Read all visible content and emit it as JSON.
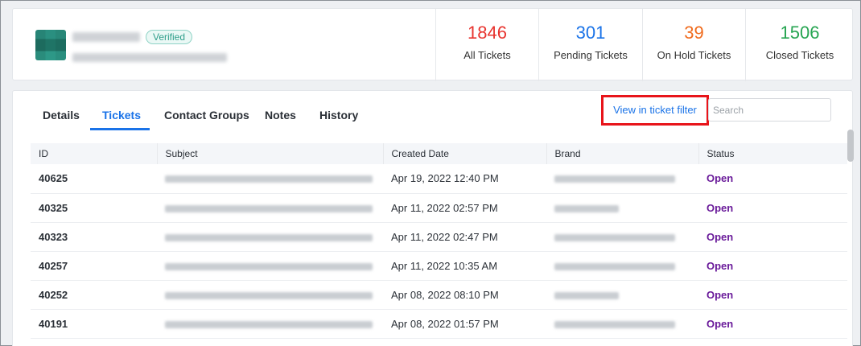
{
  "profile": {
    "verified_label": "Verified"
  },
  "stats": [
    {
      "value": "1846",
      "label": "All Tickets",
      "color": "#e8342f"
    },
    {
      "value": "301",
      "label": "Pending Tickets",
      "color": "#1a73e8"
    },
    {
      "value": "39",
      "label": "On Hold Tickets",
      "color": "#f06b1d"
    },
    {
      "value": "1506",
      "label": "Closed Tickets",
      "color": "#27a552"
    }
  ],
  "tabs": [
    "Details",
    "Tickets",
    "Contact Groups",
    "Notes",
    "History"
  ],
  "active_tab": "Tickets",
  "filter_link": "View in ticket filter",
  "search": {
    "placeholder": "Search",
    "value": ""
  },
  "table": {
    "columns": [
      "ID",
      "Subject",
      "Created Date",
      "Brand",
      "Status"
    ],
    "rows": [
      {
        "id": "40625",
        "created": "Apr 19, 2022 12:40 PM",
        "status": "Open"
      },
      {
        "id": "40325",
        "created": "Apr 11, 2022 02:57 PM",
        "status": "Open"
      },
      {
        "id": "40323",
        "created": "Apr 11, 2022 02:47 PM",
        "status": "Open"
      },
      {
        "id": "40257",
        "created": "Apr 11, 2022 10:35 AM",
        "status": "Open"
      },
      {
        "id": "40252",
        "created": "Apr 08, 2022 08:10 PM",
        "status": "Open"
      },
      {
        "id": "40191",
        "created": "Apr 08, 2022 01:57 PM",
        "status": "Open"
      }
    ]
  },
  "colors": {
    "accent": "#1a73e8",
    "status_open": "#6a1b9a",
    "highlight": "#e8141a"
  }
}
